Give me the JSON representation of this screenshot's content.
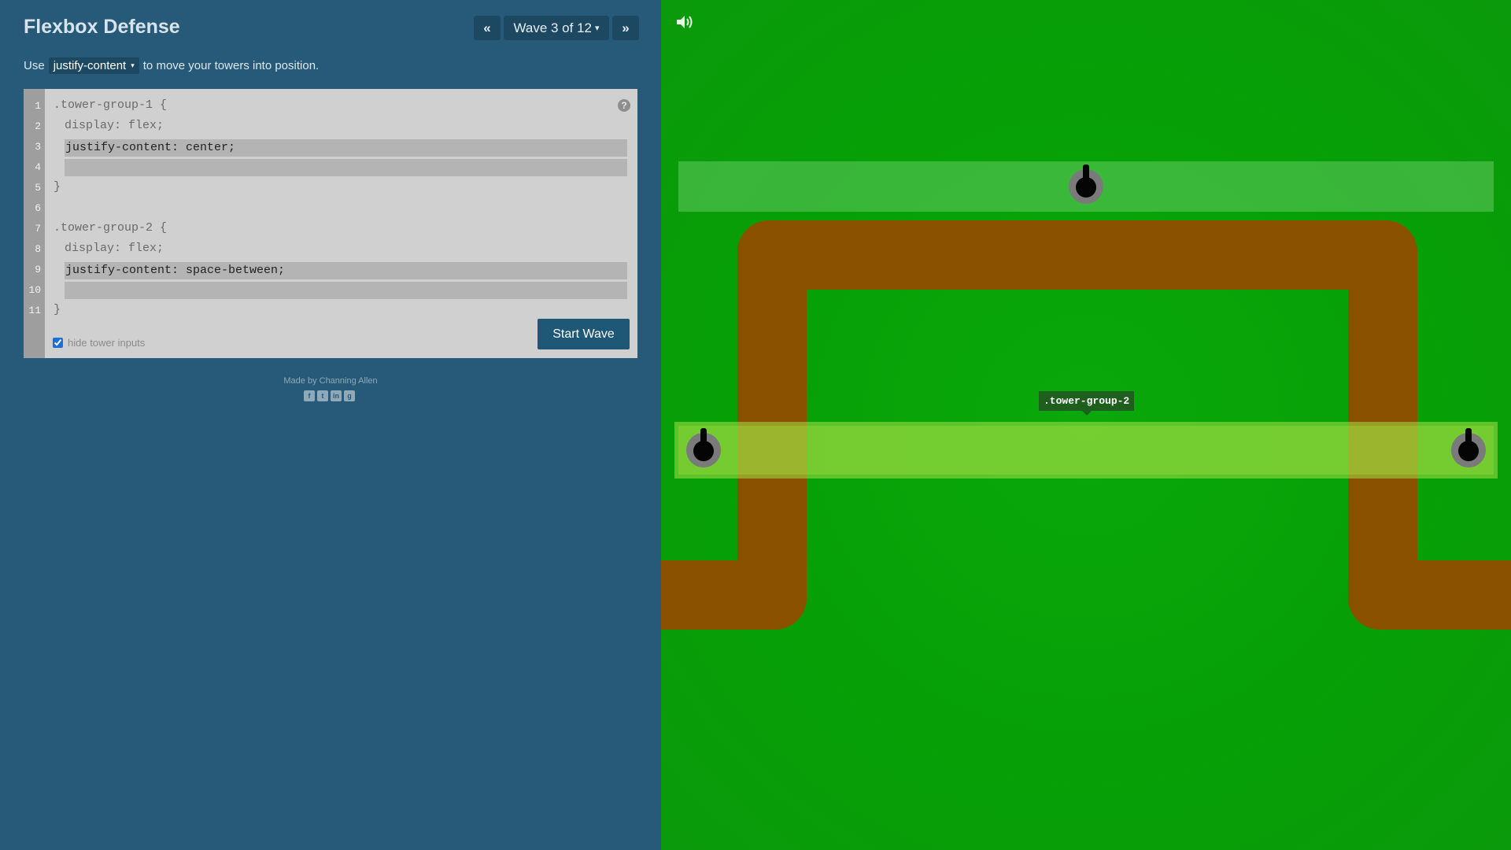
{
  "header": {
    "title": "Flexbox Defense",
    "prev_label": "«",
    "next_label": "»",
    "wave_label": "Wave 3 of 12",
    "wave_caret": "▾"
  },
  "instruction": {
    "prefix": "Use",
    "property": "justify-content",
    "caret": "▾",
    "suffix": "to move your towers into position."
  },
  "editor": {
    "line_numbers": [
      "1",
      "2",
      "3",
      "4",
      "5",
      "6",
      "7",
      "8",
      "9",
      "10",
      "11"
    ],
    "group1_selector": ".tower-group-1 {",
    "group1_display": "display: flex;",
    "group1_input": "justify-content: center;",
    "group1_close": "}",
    "group2_selector": ".tower-group-2 {",
    "group2_display": "display: flex;",
    "group2_input": "justify-content: space-between;",
    "group2_close": "}",
    "help": "?",
    "hide_inputs_label": "hide tower inputs",
    "hide_inputs_checked": true,
    "start_button": "Start Wave"
  },
  "footer": {
    "credit": "Made by Channing Allen",
    "socials": [
      "facebook-icon",
      "twitter-icon",
      "linkedin-icon",
      "github-icon"
    ]
  },
  "board": {
    "tooltip": ".tower-group-2",
    "sound_icon": "speaker-icon",
    "colors": {
      "grass": "#06a006",
      "path": "#8a5100",
      "tower_ring": "#7a7a7a",
      "tower_core": "#050505"
    }
  }
}
